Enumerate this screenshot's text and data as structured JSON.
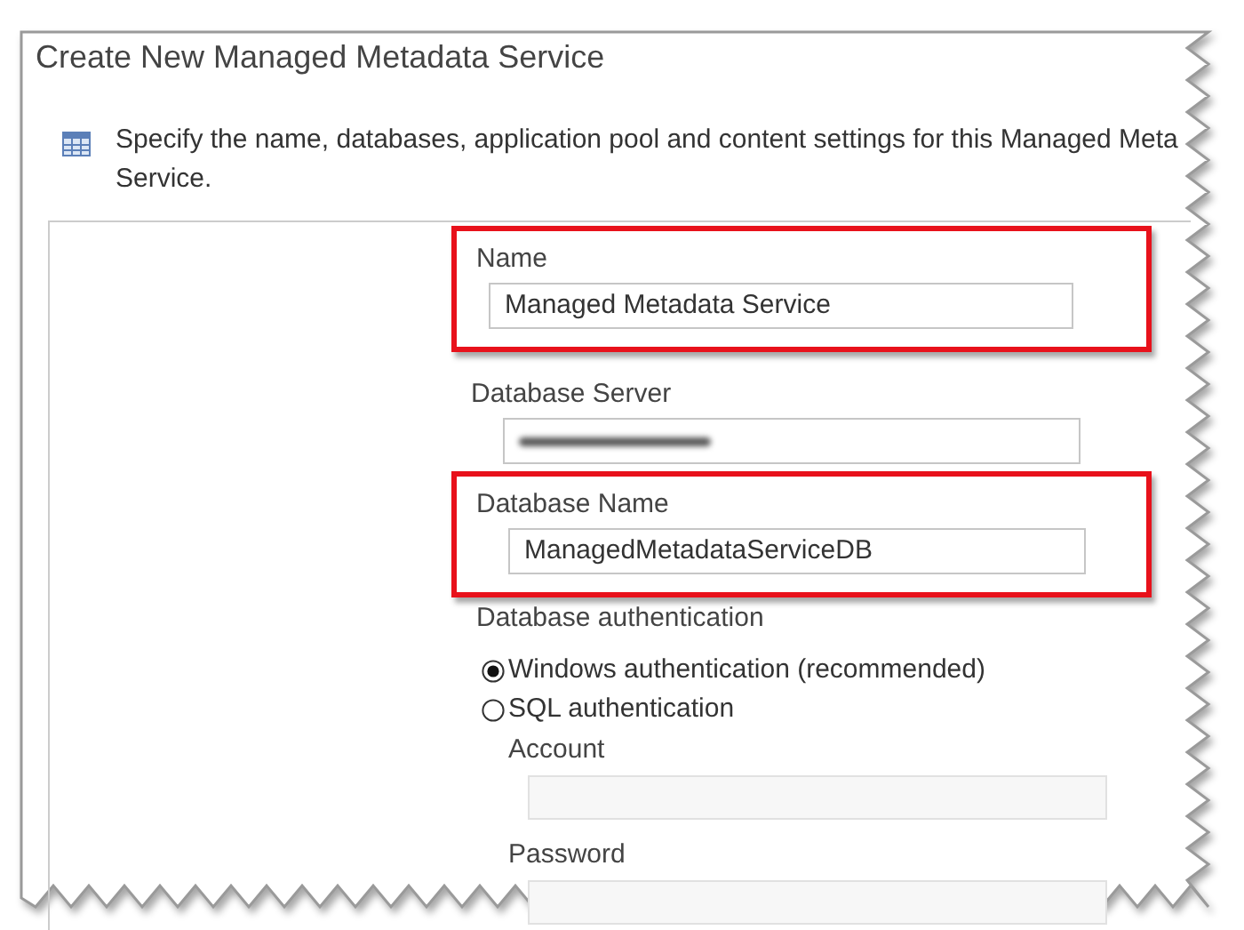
{
  "title": "Create New Managed Metadata Service",
  "description_lines": [
    "Specify the name, databases, application pool and content settings for this Managed Meta",
    "Service."
  ],
  "fields": [
    {
      "kind": "text",
      "label": "Name",
      "value": "Managed Metadata Service",
      "highlighted": true
    },
    {
      "kind": "redacted",
      "label": "Database Server",
      "highlighted": false
    },
    {
      "kind": "text",
      "label": "Database Name",
      "value": "ManagedMetadataServiceDB",
      "highlighted": true
    }
  ],
  "authentication": {
    "label": "Database authentication",
    "options": [
      {
        "label": "Windows authentication (recommended)",
        "selected": true
      },
      {
        "label": "SQL authentication",
        "selected": false
      }
    ]
  },
  "sql_fields": [
    {
      "label": "Account",
      "disabled": true
    },
    {
      "label": "Password",
      "disabled": true
    }
  ]
}
